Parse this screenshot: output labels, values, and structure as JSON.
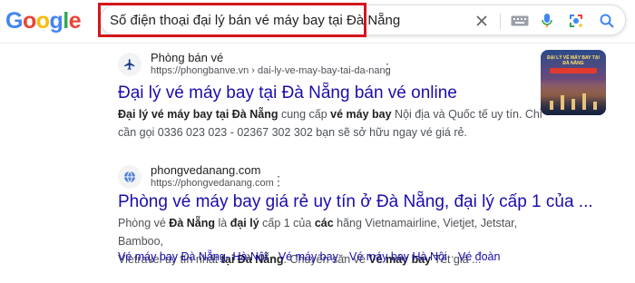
{
  "header": {
    "logo": [
      "G",
      "o",
      "o",
      "g",
      "l",
      "e"
    ],
    "logo_colors": [
      "#4285F4",
      "#EA4335",
      "#FBBC05",
      "#4285F4",
      "#34A853",
      "#EA4335"
    ],
    "search_query": "Số điện thoại đại lý bán vé máy bay tại Đà Nẵng",
    "highlight_color": "#d3171c"
  },
  "results": [
    {
      "site_name": "Phòng bán vé",
      "url": "https://phongbanve.vn › dai-ly-ve-may-bay-tai-da-nang",
      "title": "Đại lý vé máy bay tại Đà Nẵng bán vé online",
      "snippet_line1": [
        {
          "t": "Đại lý vé máy bay tại Đà Nẵng",
          "b": true
        },
        {
          "t": " cung cấp ",
          "b": false
        },
        {
          "t": "vé máy bay",
          "b": true
        },
        {
          "t": " Nội địa và Quốc tế uy tín. Chỉ",
          "b": false
        }
      ],
      "snippet_line2": "cần gọi 0336 023 023 - 02367 302 302 bạn sẽ sở hữu ngay vé giá rẻ.",
      "thumbnail_text": "ĐẠI LÝ VÉ MÁY BAY TẠI ĐÀ NẴNG"
    },
    {
      "site_name": "phongvedanang.com",
      "url": "https://phongvedanang.com",
      "title": "Phòng vé máy bay giá rẻ uy tín ở Đà Nẵng, đại lý cấp 1 của ...",
      "snippet_line1": [
        {
          "t": "Phòng vé ",
          "b": false
        },
        {
          "t": "Đà Nẵng",
          "b": true
        },
        {
          "t": " là ",
          "b": false
        },
        {
          "t": "đại lý",
          "b": true
        },
        {
          "t": " cấp 1 của ",
          "b": false
        },
        {
          "t": "các",
          "b": true
        },
        {
          "t": " hãng Vietnamairline, Vietjet, Jetstar, Bamboo,",
          "b": false
        }
      ],
      "snippet_line2": [
        {
          "t": "Vietravel uy tín nhất ",
          "b": false
        },
        {
          "t": "tại Đà Nẵng",
          "b": true
        },
        {
          "t": ". Chuyên săn vé ",
          "b": false
        },
        {
          "t": "Vé máy bay",
          "b": true
        },
        {
          "t": " Tết giá ...",
          "b": false
        }
      ],
      "sitelinks": [
        "Vé máy bay Đà Nẵng- Hà Nội",
        "Vé máy bay",
        "Vé máy bay Hà Nội",
        "Vé đoàn"
      ],
      "sitelink_separator": "·"
    }
  ],
  "icons": {
    "clear": "close-icon",
    "keyboard": "keyboard-icon",
    "voice": "microphone-icon",
    "lens": "lens-camera-icon",
    "search": "search-icon",
    "favicon1": "airplane-icon",
    "favicon2": "globe-icon",
    "more": "more-vert-icon"
  }
}
